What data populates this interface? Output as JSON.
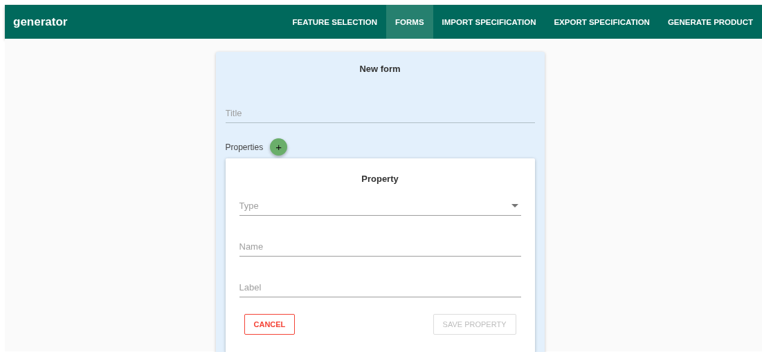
{
  "app_bar": {
    "title": "generator",
    "tabs": [
      {
        "label": "FEATURE SELECTION",
        "selected": false
      },
      {
        "label": "FORMS",
        "selected": true
      },
      {
        "label": "IMPORT SPECIFICATION",
        "selected": false
      },
      {
        "label": "EXPORT SPECIFICATION",
        "selected": false
      },
      {
        "label": "GENERATE PRODUCT",
        "selected": false
      }
    ]
  },
  "form": {
    "heading": "New form",
    "title_field": {
      "placeholder": "Title"
    },
    "properties_label": "Properties",
    "add_button": "+",
    "property": {
      "heading": "Property",
      "fields": [
        {
          "kind": "select",
          "placeholder": "Type"
        },
        {
          "kind": "text",
          "placeholder": "Name"
        },
        {
          "kind": "text",
          "placeholder": "Label"
        }
      ],
      "buttons": [
        {
          "label": "CANCEL",
          "kind": "cancel",
          "disabled": false
        },
        {
          "label": "SAVE PROPERTY",
          "kind": "save",
          "disabled": true
        }
      ]
    }
  }
}
